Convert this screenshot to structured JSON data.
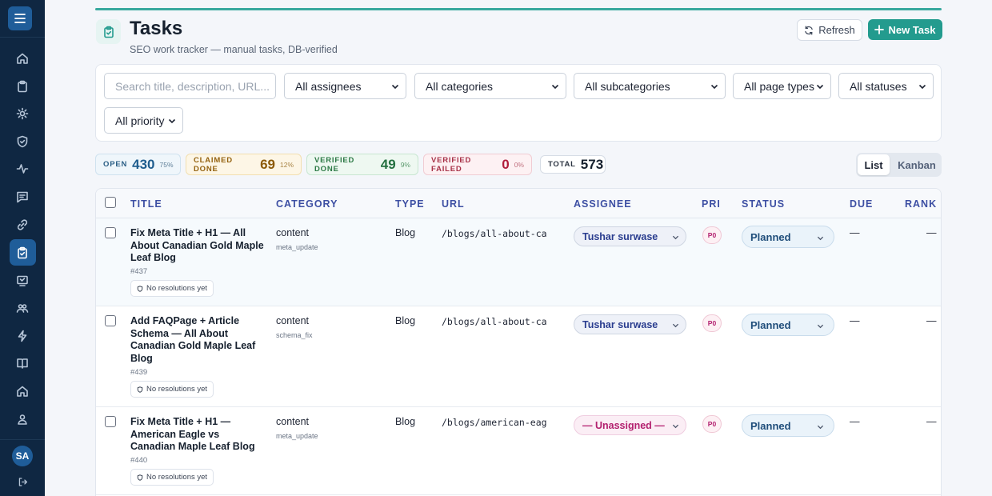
{
  "header": {
    "title": "Tasks",
    "subtitle": "SEO work tracker — manual tasks, DB-verified",
    "refresh_label": "Refresh",
    "new_task_label": "New Task",
    "accent_color": "#239b8e"
  },
  "sidebar": {
    "items": [
      {
        "icon": "home-icon"
      },
      {
        "icon": "clipboard-icon"
      },
      {
        "icon": "settings-icon"
      },
      {
        "icon": "shield-icon"
      },
      {
        "icon": "activity-icon"
      },
      {
        "icon": "message-icon"
      },
      {
        "icon": "link-icon"
      },
      {
        "icon": "tasks-icon",
        "active": true
      },
      {
        "icon": "chat-icon"
      },
      {
        "icon": "users-icon"
      },
      {
        "icon": "bolt-icon"
      },
      {
        "icon": "book-icon"
      },
      {
        "icon": "home-alt-icon"
      },
      {
        "icon": "user-group-icon"
      }
    ],
    "avatar_initials": "SA"
  },
  "filters": {
    "search_placeholder": "Search title, description, URL...",
    "assignees": "All assignees",
    "categories": "All categories",
    "subcategories": "All subcategories",
    "page_types": "All page types",
    "statuses": "All statuses",
    "priority": "All priority"
  },
  "stats": {
    "open": {
      "label": "OPEN",
      "value": "430",
      "pct": "75%"
    },
    "claimed_done": {
      "label": "CLAIMED DONE",
      "value": "69",
      "pct": "12%"
    },
    "verified_done": {
      "label": "VERIFIED DONE",
      "value": "49",
      "pct": "9%"
    },
    "verified_failed": {
      "label": "VERIFIED FAILED",
      "value": "0",
      "pct": "0%"
    },
    "total": {
      "label": "TOTAL",
      "value": "573"
    }
  },
  "view_toggle": {
    "list": "List",
    "kanban": "Kanban",
    "selected": "List"
  },
  "table": {
    "columns": {
      "title": "TITLE",
      "category": "CATEGORY",
      "type": "TYPE",
      "url": "URL",
      "assignee": "ASSIGNEE",
      "pri": "PRI",
      "status": "STATUS",
      "due": "DUE",
      "rank": "RANK"
    },
    "rows": [
      {
        "title": "Fix Meta Title + H1 — All About Canadian Gold Maple Leaf Blog",
        "id": "#437",
        "resolutions": "No resolutions yet",
        "category": "content",
        "subcategory": "meta_update",
        "type": "Blog",
        "url": "/blogs/all-about-ca",
        "assignee": "Tushar surwase",
        "priority": "P0",
        "status": "Planned",
        "due": "—",
        "rank": "—"
      },
      {
        "title": "Add FAQPage + Article Schema — All About Canadian Gold Maple Leaf Blog",
        "id": "#439",
        "resolutions": "No resolutions yet",
        "category": "content",
        "subcategory": "schema_fix",
        "type": "Blog",
        "url": "/blogs/all-about-ca",
        "assignee": "Tushar surwase",
        "priority": "P0",
        "status": "Planned",
        "due": "—",
        "rank": "—"
      },
      {
        "title": "Fix Meta Title + H1 — American Eagle vs Canadian Maple Leaf Blog",
        "id": "#440",
        "resolutions": "No resolutions yet",
        "category": "content",
        "subcategory": "meta_update",
        "type": "Blog",
        "url": "/blogs/american-eag",
        "assignee": "— Unassigned —",
        "priority": "P0",
        "status": "Planned",
        "due": "—",
        "rank": "—"
      }
    ]
  }
}
